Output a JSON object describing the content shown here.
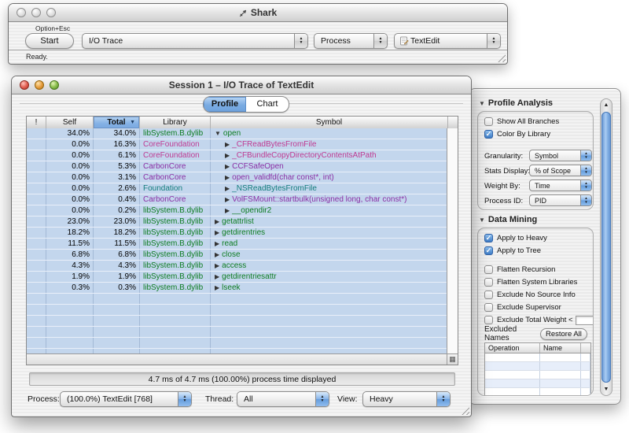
{
  "icons": {
    "check": "✓",
    "disclosure_expanded": "▼",
    "disclosure_collapsed": "▶",
    "sort_desc": "▼",
    "up_arrow": "▲",
    "down_arrow": "▼",
    "grid": "▦",
    "section_open": "▼"
  },
  "colors": {
    "accent_blue": "#3e7cc6",
    "row_blue": "#c3d6ed",
    "sorted_header_blue": "#84b1e5",
    "library_colors": {
      "libSystem.B.dylib": "#0d7c21",
      "CoreFoundation": "#bf3a92",
      "CarbonCore": "#8b2fa5",
      "Foundation": "#127c7c"
    }
  },
  "shark_window": {
    "title": "Shark",
    "shortcut_label": "Option+Esc",
    "start_button": "Start",
    "config_popup_value": "I/O Trace",
    "target_popup_value": "Process",
    "process_popup_value": "TextEdit",
    "status": "Ready."
  },
  "session_window": {
    "title": "Session 1 – I/O Trace of TextEdit",
    "tabs": [
      {
        "label": "Profile",
        "selected": true
      },
      {
        "label": "Chart",
        "selected": false
      }
    ],
    "table": {
      "columns": [
        "!",
        "Self",
        "Total",
        "Library",
        "Symbol"
      ],
      "sort_column": "Total",
      "sort_direction": "descending",
      "rows": [
        {
          "self": "34.0%",
          "total": "34.0%",
          "library": "libSystem.B.dylib",
          "symbol": "open",
          "disclosure": "expanded",
          "indent": 0
        },
        {
          "self": "0.0%",
          "total": "16.3%",
          "library": "CoreFoundation",
          "symbol": "_CFReadBytesFromFile",
          "disclosure": "collapsed",
          "indent": 1
        },
        {
          "self": "0.0%",
          "total": "6.1%",
          "library": "CoreFoundation",
          "symbol": "_CFBundleCopyDirectoryContentsAtPath",
          "disclosure": "collapsed",
          "indent": 1
        },
        {
          "self": "0.0%",
          "total": "5.3%",
          "library": "CarbonCore",
          "symbol": "CCFSafeOpen",
          "disclosure": "collapsed",
          "indent": 1
        },
        {
          "self": "0.0%",
          "total": "3.1%",
          "library": "CarbonCore",
          "symbol": "open_validfd(char const*, int)",
          "disclosure": "collapsed",
          "indent": 1
        },
        {
          "self": "0.0%",
          "total": "2.6%",
          "library": "Foundation",
          "symbol": "_NSReadBytesFromFile",
          "disclosure": "collapsed",
          "indent": 1
        },
        {
          "self": "0.0%",
          "total": "0.4%",
          "library": "CarbonCore",
          "symbol": "VolFSMount::startbulk(unsigned long, char const*)",
          "disclosure": "collapsed",
          "indent": 1
        },
        {
          "self": "0.0%",
          "total": "0.2%",
          "library": "libSystem.B.dylib",
          "symbol": "__opendir2",
          "disclosure": "collapsed",
          "indent": 1
        },
        {
          "self": "23.0%",
          "total": "23.0%",
          "library": "libSystem.B.dylib",
          "symbol": "getattrlist",
          "disclosure": "collapsed",
          "indent": 0
        },
        {
          "self": "18.2%",
          "total": "18.2%",
          "library": "libSystem.B.dylib",
          "symbol": "getdirentries",
          "disclosure": "collapsed",
          "indent": 0
        },
        {
          "self": "11.5%",
          "total": "11.5%",
          "library": "libSystem.B.dylib",
          "symbol": "read",
          "disclosure": "collapsed",
          "indent": 0
        },
        {
          "self": "6.8%",
          "total": "6.8%",
          "library": "libSystem.B.dylib",
          "symbol": "close",
          "disclosure": "collapsed",
          "indent": 0
        },
        {
          "self": "4.3%",
          "total": "4.3%",
          "library": "libSystem.B.dylib",
          "symbol": "access",
          "disclosure": "collapsed",
          "indent": 0
        },
        {
          "self": "1.9%",
          "total": "1.9%",
          "library": "libSystem.B.dylib",
          "symbol": "getdirentriesattr",
          "disclosure": "collapsed",
          "indent": 0
        },
        {
          "self": "0.3%",
          "total": "0.3%",
          "library": "libSystem.B.dylib",
          "symbol": "lseek",
          "disclosure": "collapsed",
          "indent": 0
        }
      ],
      "empty_filler_rows": 6
    },
    "status_text": "4.7 ms of 4.7 ms (100.00%) process time displayed",
    "process_label": "Process:",
    "process_value": "(100.0%) TextEdit [768]",
    "thread_label": "Thread:",
    "thread_value": "All",
    "view_label": "View:",
    "view_value": "Heavy"
  },
  "drawer": {
    "profile_analysis": {
      "title": "Profile Analysis",
      "checkboxes": [
        {
          "label": "Show All Branches",
          "checked": false
        },
        {
          "label": "Color By Library",
          "checked": true
        }
      ],
      "popups": [
        {
          "name": "granularity",
          "label": "Granularity:",
          "value": "Symbol"
        },
        {
          "name": "stats-display",
          "label": "Stats Display:",
          "value": "% of Scope"
        },
        {
          "name": "weight-by",
          "label": "Weight By:",
          "value": "Time"
        },
        {
          "name": "process-id",
          "label": "Process ID:",
          "value": "PID"
        }
      ]
    },
    "data_mining": {
      "title": "Data Mining",
      "checkboxes_top": [
        {
          "label": "Apply to Heavy",
          "checked": true
        },
        {
          "label": "Apply to Tree",
          "checked": true
        }
      ],
      "checkboxes_bottom": [
        {
          "label": "Flatten Recursion",
          "checked": false
        },
        {
          "label": "Flatten System Libraries",
          "checked": false
        },
        {
          "label": "Exclude No Source Info",
          "checked": false
        },
        {
          "label": "Exclude Supervisor",
          "checked": false
        },
        {
          "label": "Exclude Total Weight <",
          "checked": false,
          "input": ""
        }
      ],
      "excluded_names_label": "Excluded Names",
      "restore_all_button": "Restore All",
      "excluded_table_columns": [
        "Operation",
        "Name"
      ],
      "excluded_table_rows": [],
      "empty_excluded_rows": 6
    }
  }
}
